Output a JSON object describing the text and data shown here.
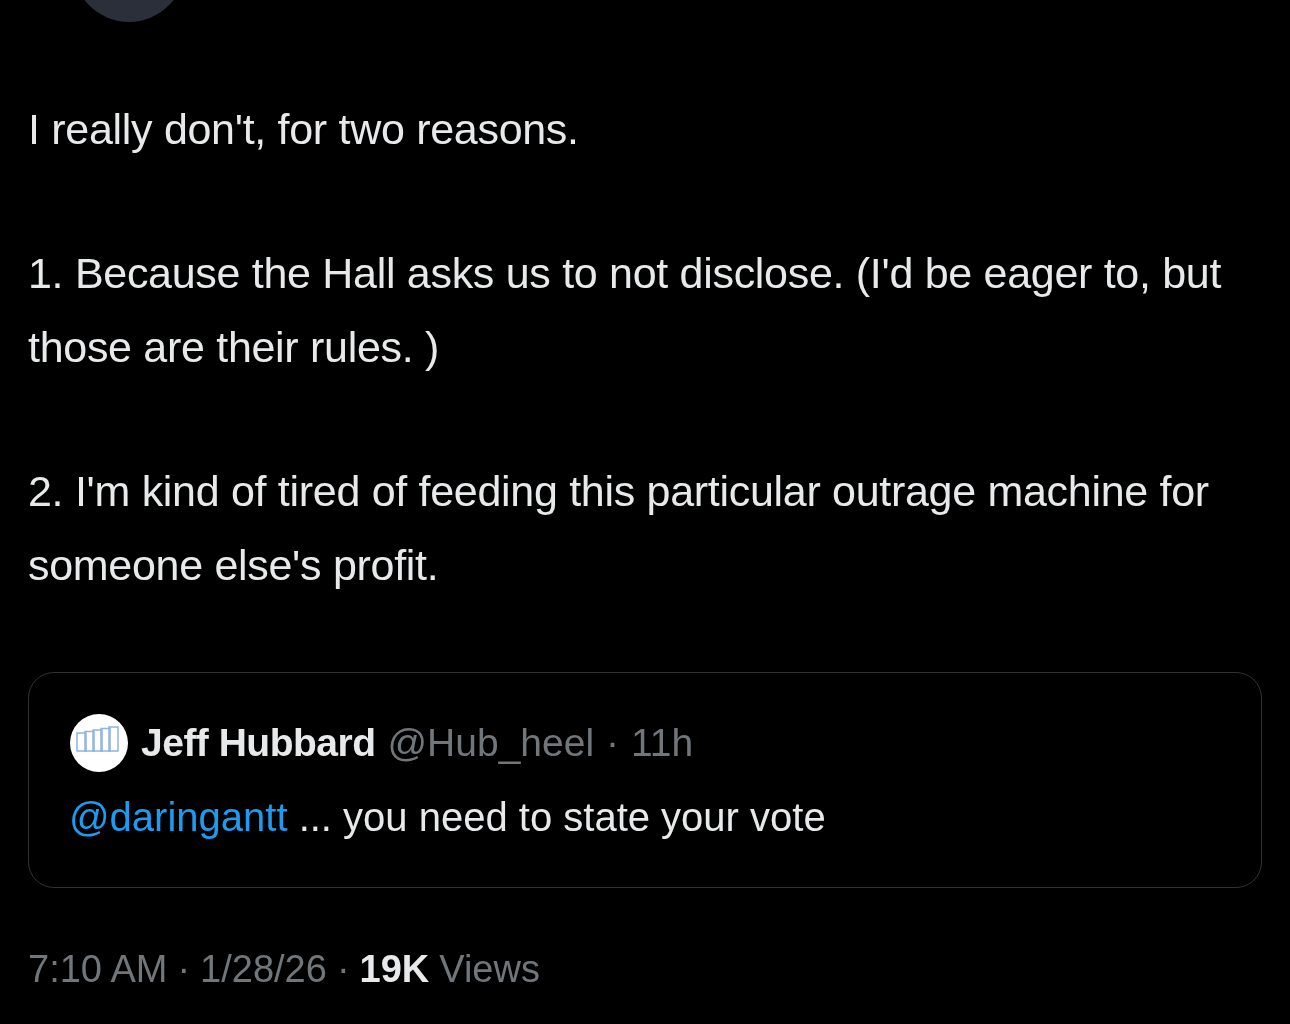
{
  "post": {
    "paragraphs": [
      "I really don't, for two reasons.",
      "1. Because the Hall asks us to not disclose.  (I'd be eager to, but those are their rules. )",
      "2. I'm kind of tired of feeding this particular outrage machine for someone else's profit."
    ]
  },
  "quoted_post": {
    "name": "Jeff Hubbard",
    "handle": "@Hub_heel",
    "separator": "·",
    "age": "11h",
    "mention": "@daringantt",
    "text": "... you need to state your vote"
  },
  "footer": {
    "time": "7:10 AM",
    "separator": "·",
    "date": "1/28/26",
    "views": "19K",
    "views_label": "Views"
  }
}
